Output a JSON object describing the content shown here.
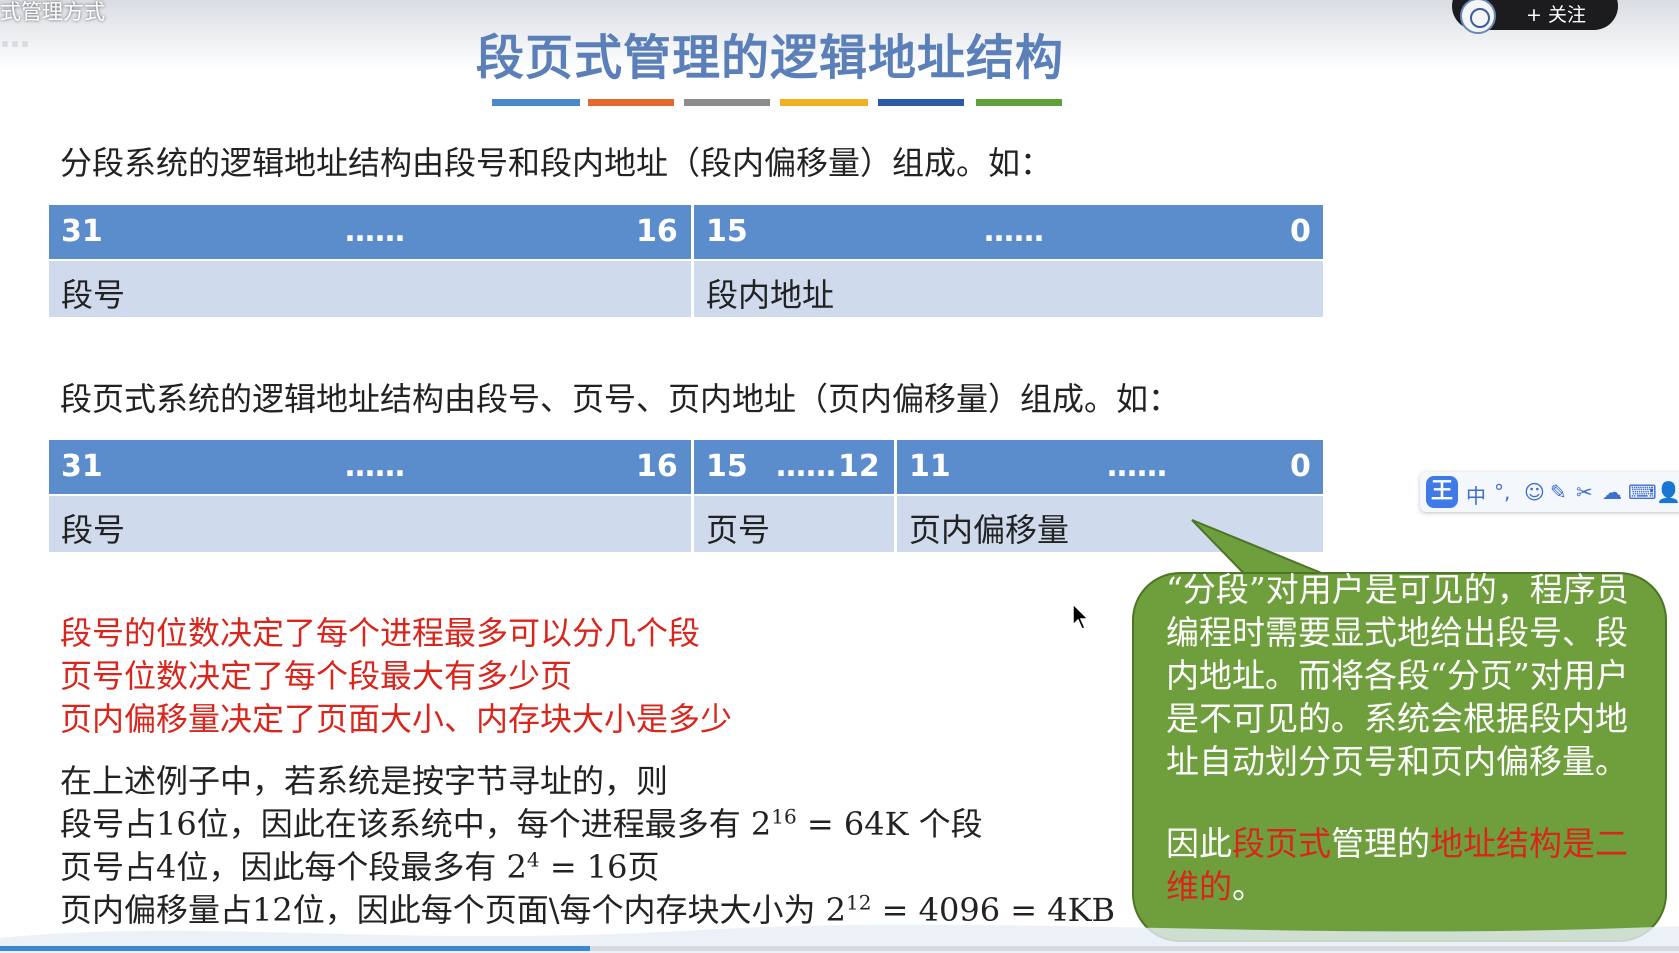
{
  "video": {
    "title": "式管理方式",
    "watermark": "…",
    "follow_label": "+ 关注"
  },
  "slide": {
    "title": "段页式管理的逻辑地址结构",
    "title_bar_colors": [
      "#4a8acb",
      "#e3692f",
      "#8c8c8c",
      "#f0b020",
      "#2d5aa6",
      "#5fa03a"
    ],
    "para1": "分段系统的逻辑地址结构由段号和段内地址（段内偏移量）组成。如：",
    "table1": {
      "h1_left": "31",
      "h1_mid": "……",
      "h1_right": "16",
      "h2_left": "15",
      "h2_mid": "……",
      "h2_right": "0",
      "b1": "段号",
      "b2": "段内地址"
    },
    "para2": "段页式系统的逻辑地址结构由段号、页号、页内地址（页内偏移量）组成。如：",
    "table2": {
      "h1_left": "31",
      "h1_mid": "……",
      "h1_right": "16",
      "h2_left": "15",
      "h2_mid": "……",
      "h2_right": "12",
      "h3_left": "11",
      "h3_mid": "……",
      "h3_right": "0",
      "b1": "段号",
      "b2": "页号",
      "b3": "页内偏移量"
    },
    "red_lines": [
      "段号的位数决定了每个进程最多可以分几个段",
      "页号位数决定了每个段最大有多少页",
      "页内偏移量决定了页面大小、内存块大小是多少"
    ],
    "example_intro": "在上述例子中，若系统是按字节寻址的，则",
    "ex1_pre": "段号占16位，因此在该系统中，每个进程最多有 2",
    "ex1_sup": "16",
    "ex1_post": " = 64K 个段",
    "ex2_pre": "页号占4位，因此每个段最多有 2",
    "ex2_sup": "4",
    "ex2_post": " = 16页",
    "ex3_pre": "页内偏移量占12位，因此每个页面\\每个内存块大小为 2",
    "ex3_sup": "12",
    "ex3_post": " = 4096 = 4KB",
    "bubble": {
      "text": "“分段”对用户是可见的，程序员编程时需要显式地给出段号、段内地址。而将各段“分页”对用户是不可见的。系统会根据段内地址自动划分页号和页内偏移量。",
      "conclusion_a": "因此",
      "conclusion_b": "段页式",
      "conclusion_c": "管理的",
      "conclusion_d": "地址结构是二维的",
      "conclusion_e": "。"
    }
  },
  "ime_toolbar": {
    "logo": "王",
    "items": [
      "中",
      "°,",
      "☺",
      "✎",
      "✂",
      "☁",
      "⌨",
      "👤"
    ]
  },
  "colors": {
    "title": "#5b7fb9",
    "header_cell": "#5b8ccc",
    "body_cell": "#cfdaec",
    "red": "#d9261c",
    "bubble": "#6f9f3c"
  }
}
